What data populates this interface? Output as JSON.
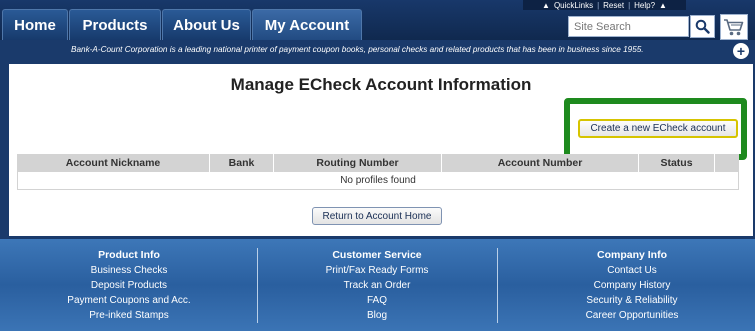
{
  "nav": {
    "tabs": [
      {
        "label": "Home"
      },
      {
        "label": "Products"
      },
      {
        "label": "About Us"
      },
      {
        "label": "My Account"
      }
    ]
  },
  "quicklinks": {
    "quicklinks": "QuickLinks",
    "reset": "Reset",
    "help": "Help?"
  },
  "search": {
    "placeholder": "Site Search"
  },
  "tagline": "Bank-A-Count Corporation is a leading national printer of payment coupon books, personal checks and related products that has been in business since 1955.",
  "main": {
    "title": "Manage ECheck Account Information",
    "create_button": "Create a new ECheck account",
    "table": {
      "headers": [
        "Account Nickname",
        "Bank",
        "Routing Number",
        "Account Number",
        "Status",
        ""
      ],
      "empty_message": "No profiles found"
    },
    "return_button": "Return to Account Home"
  },
  "footer": {
    "product_info": {
      "heading": "Product Info",
      "links": [
        "Business Checks",
        "Deposit Products",
        "Payment Coupons and Acc.",
        "Pre-inked Stamps"
      ]
    },
    "customer_service": {
      "heading": "Customer Service",
      "links": [
        "Print/Fax Ready Forms",
        "Track an Order",
        "FAQ",
        "Blog"
      ]
    },
    "company_info": {
      "heading": "Company Info",
      "links": [
        "Contact Us",
        "Company History",
        "Security & Reliability",
        "Career Opportunities"
      ]
    }
  },
  "colors": {
    "highlight": "#1e8a1e",
    "navy": "#1a3a6b",
    "footer_blue": "#3d77b8"
  }
}
